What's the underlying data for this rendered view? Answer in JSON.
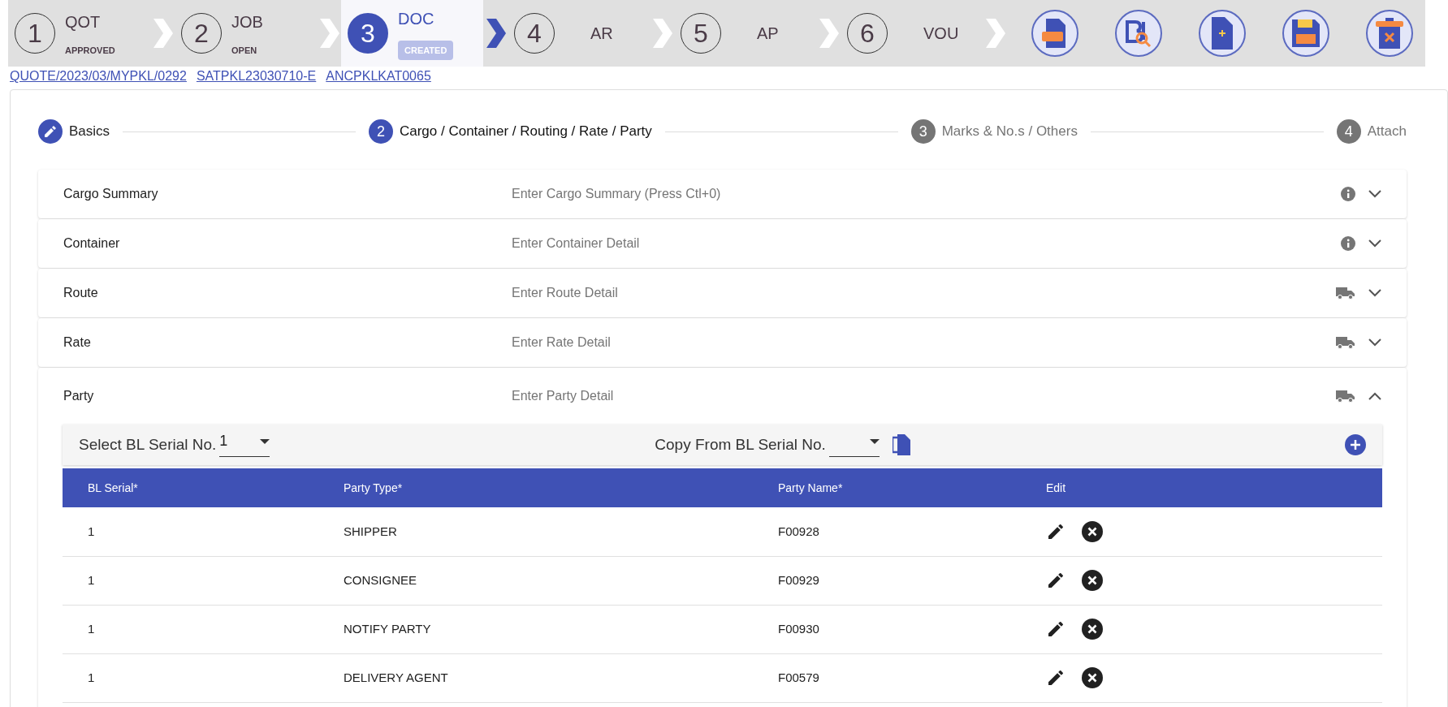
{
  "pipeline": [
    {
      "number": "1",
      "label": "QOT",
      "sublabel": "APPROVED",
      "selected": false
    },
    {
      "number": "2",
      "label": "JOB",
      "sublabel": "OPEN",
      "selected": false
    },
    {
      "number": "3",
      "label": "DOC",
      "sublabel": "CREATED",
      "selected": true
    },
    {
      "number": "4",
      "label": "AR",
      "selected": false
    },
    {
      "number": "5",
      "label": "AP",
      "selected": false
    },
    {
      "number": "6",
      "label": "VOU",
      "selected": false
    }
  ],
  "actions": [
    {
      "kind": "pdf"
    },
    {
      "kind": "bl-search"
    },
    {
      "kind": "new-doc"
    },
    {
      "kind": "save"
    },
    {
      "kind": "delete"
    }
  ],
  "links": [
    "QUOTE/2023/03/MYPKL/0292",
    "SATPKL23030710-E",
    "ANCPKLKAT0065"
  ],
  "stepper": [
    {
      "label": "Basics",
      "kind": "done"
    },
    {
      "number": "2",
      "label": "Cargo / Container / Routing / Rate / Party",
      "kind": "active"
    },
    {
      "number": "3",
      "label": "Marks & No.s / Others",
      "kind": "pending"
    },
    {
      "number": "4",
      "label": "Attach",
      "kind": "pending"
    }
  ],
  "sections": [
    {
      "title": "Cargo Summary",
      "placeholder": "Enter Cargo Summary (Press Ctl+0)",
      "kind": "info",
      "expanded": false
    },
    {
      "title": "Container",
      "placeholder": "Enter Container Detail",
      "kind": "info",
      "expanded": false
    },
    {
      "title": "Route",
      "placeholder": "Enter Route Detail",
      "kind": "truck",
      "expanded": false
    },
    {
      "title": "Rate",
      "placeholder": "Enter Rate Detail",
      "kind": "truck",
      "expanded": false
    },
    {
      "title": "Party",
      "placeholder": "Enter Party Detail",
      "kind": "truck",
      "expanded": true
    }
  ],
  "party_panel": {
    "select_label": "Select BL Serial No.",
    "select_value": "1",
    "copy_label": "Copy From BL Serial No.",
    "columns": [
      "BL Serial*",
      "Party Type*",
      "Party Name*",
      "Edit"
    ],
    "rows": [
      [
        "1",
        "SHIPPER",
        "F00928"
      ],
      [
        "1",
        "CONSIGNEE",
        "F00929"
      ],
      [
        "1",
        "NOTIFY PARTY",
        "F00930"
      ],
      [
        "1",
        "DELIVERY AGENT",
        "F00579"
      ]
    ]
  }
}
